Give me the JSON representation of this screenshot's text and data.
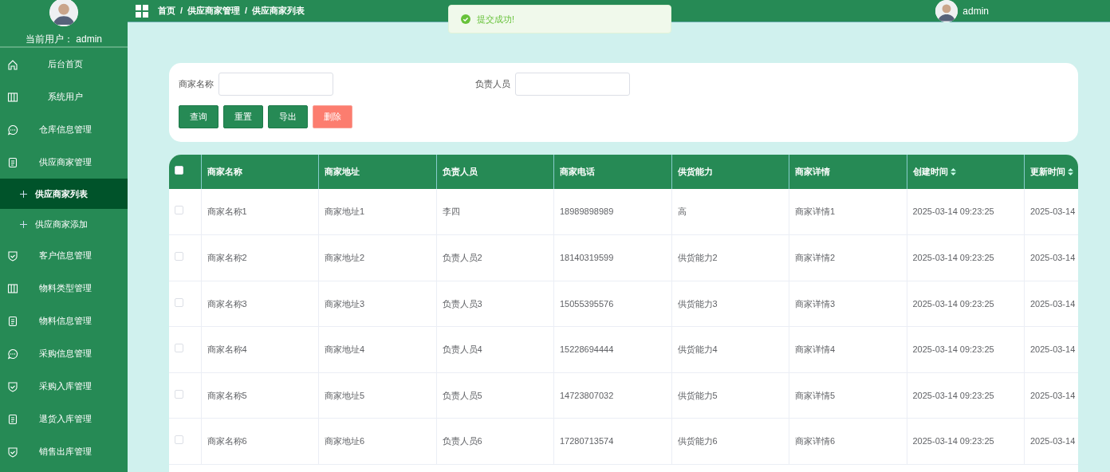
{
  "sidebar": {
    "current_user_label": "当前用户：",
    "current_user": "admin",
    "items": [
      {
        "label": "后台首页",
        "selected": false
      },
      {
        "label": "系统用户",
        "selected": false
      },
      {
        "label": "仓库信息管理",
        "selected": false
      },
      {
        "label": "供应商家管理",
        "selected": false,
        "expanded": true,
        "children": [
          {
            "label": "供应商家列表",
            "selected": true
          },
          {
            "label": "供应商家添加",
            "selected": false
          }
        ]
      },
      {
        "label": "客户信息管理",
        "selected": false
      },
      {
        "label": "物料类型管理",
        "selected": false
      },
      {
        "label": "物料信息管理",
        "selected": false
      },
      {
        "label": "采购信息管理",
        "selected": false
      },
      {
        "label": "采购入库管理",
        "selected": false
      },
      {
        "label": "退货入库管理",
        "selected": false
      },
      {
        "label": "销售出库管理",
        "selected": false
      }
    ]
  },
  "header": {
    "breadcrumb": [
      "首页",
      "供应商家管理",
      "供应商家列表"
    ],
    "separator": "/",
    "user": "admin"
  },
  "toast": {
    "message": "提交成功!"
  },
  "search": {
    "fields": [
      {
        "label": "商家名称"
      },
      {
        "label": "负责人员"
      }
    ],
    "buttons": [
      {
        "label": "查询",
        "kind": "primary"
      },
      {
        "label": "重置",
        "kind": "primary"
      },
      {
        "label": "导出",
        "kind": "primary"
      },
      {
        "label": "删除",
        "kind": "danger"
      }
    ]
  },
  "table": {
    "select_all_checked": false,
    "columns": [
      {
        "label": "商家名称",
        "sortable": false
      },
      {
        "label": "商家地址",
        "sortable": false
      },
      {
        "label": "负责人员",
        "sortable": false
      },
      {
        "label": "商家电话",
        "sortable": false
      },
      {
        "label": "供货能力",
        "sortable": false
      },
      {
        "label": "商家详情",
        "sortable": false
      },
      {
        "label": "创建时间",
        "sortable": true
      },
      {
        "label": "更新时间",
        "sortable": true
      }
    ],
    "rows": [
      {
        "checked": false,
        "cells": [
          "商家名称1",
          "商家地址1",
          "李四",
          "18989898989",
          "高",
          "商家详情1",
          "2025-03-14 09:23:25",
          "2025-03-14"
        ]
      },
      {
        "checked": false,
        "cells": [
          "商家名称2",
          "商家地址2",
          "负责人员2",
          "18140319599",
          "供货能力2",
          "商家详情2",
          "2025-03-14 09:23:25",
          "2025-03-14"
        ]
      },
      {
        "checked": false,
        "cells": [
          "商家名称3",
          "商家地址3",
          "负责人员3",
          "15055395576",
          "供货能力3",
          "商家详情3",
          "2025-03-14 09:23:25",
          "2025-03-14"
        ]
      },
      {
        "checked": false,
        "cells": [
          "商家名称4",
          "商家地址4",
          "负责人员4",
          "15228694444",
          "供货能力4",
          "商家详情4",
          "2025-03-14 09:23:25",
          "2025-03-14"
        ]
      },
      {
        "checked": false,
        "cells": [
          "商家名称5",
          "商家地址5",
          "负责人员5",
          "14723807032",
          "供货能力5",
          "商家详情5",
          "2025-03-14 09:23:25",
          "2025-03-14"
        ]
      },
      {
        "checked": false,
        "cells": [
          "商家名称6",
          "商家地址6",
          "负责人员6",
          "17280713574",
          "供货能力6",
          "商家详情6",
          "2025-03-14 09:23:25",
          "2025-03-14"
        ]
      }
    ]
  }
}
